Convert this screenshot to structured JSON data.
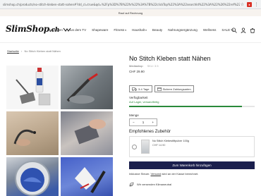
{
  "browser": {
    "url": "slimshop.ch/products/no-stitch-kleben-statt-nahen#?dd_cl=true&qd=%2Fp%3D%7B%22fv%22%3A%7B%22clickTop%22%3A%22searchId%22%3A%22%26%22ref%22%3A%22%22%2C%22ids%22%3A%5B%22c%22%2C%22fv%22%2C%22cid%22%3A%22ProductsSeo%22%2C%22nS%22%3A%22%22%2C%22searchPatternmgrsf%22"
  },
  "promo": {
    "text": "Rauf auf Rechnung"
  },
  "header": {
    "logo_main": "SlimShop",
    "logo_suffix": ".ch",
    "nav": [
      {
        "label": "Neuheiten",
        "has_caret": false
      },
      {
        "label": "Aus dem TV",
        "has_caret": false
      },
      {
        "label": "Shapeware",
        "has_caret": false
      },
      {
        "label": "Fitness",
        "has_caret": true
      },
      {
        "label": "Haushalt",
        "has_caret": true
      },
      {
        "label": "Beauty",
        "has_caret": false
      },
      {
        "label": "Nahrungsergänzung",
        "has_caret": false
      },
      {
        "label": "Wellness",
        "has_caret": false
      },
      {
        "label": "SALE %",
        "has_caret": false
      }
    ]
  },
  "breadcrumb": {
    "home": "Startseite",
    "separator": "›",
    "current": "No Stitch Kleben statt Nähen"
  },
  "product": {
    "title": "No Stitch Kleben statt Nähen",
    "vendor": "Mediashop",
    "sku": "SKU: 3.5",
    "price": "CHF 29.90",
    "chips": [
      {
        "icon": "truck-icon",
        "label": "3-4 Tage"
      },
      {
        "icon": "card-icon",
        "label": "Sichere Zahlungsarten"
      }
    ],
    "availability_label": "Verfügbarkeit",
    "availability_value": "Auf Lager, versandfertig",
    "availability_level": 0.9,
    "quantity_label": "Menge",
    "quantity_value": "1",
    "qty_minus": "−",
    "qty_plus": "+",
    "recommended_label": "Empfohlenes Zubehör",
    "recommended": {
      "name": "No Stitch Klebestiftpulver 100g",
      "price": "CHF 14.90"
    },
    "cart_button": "Zum Warenkorb hinzufügen",
    "note_prefix": "Inklusive Steuer.",
    "note_link": "Versand",
    "note_suffix": "wird an der Kasse berechnet.",
    "shipping_text": "Wir versenden Klimaneutral"
  },
  "colors": {
    "accent": "#1b1f4d",
    "stock": "#2a8a3b",
    "promo_bg": "#f7f3ef"
  }
}
